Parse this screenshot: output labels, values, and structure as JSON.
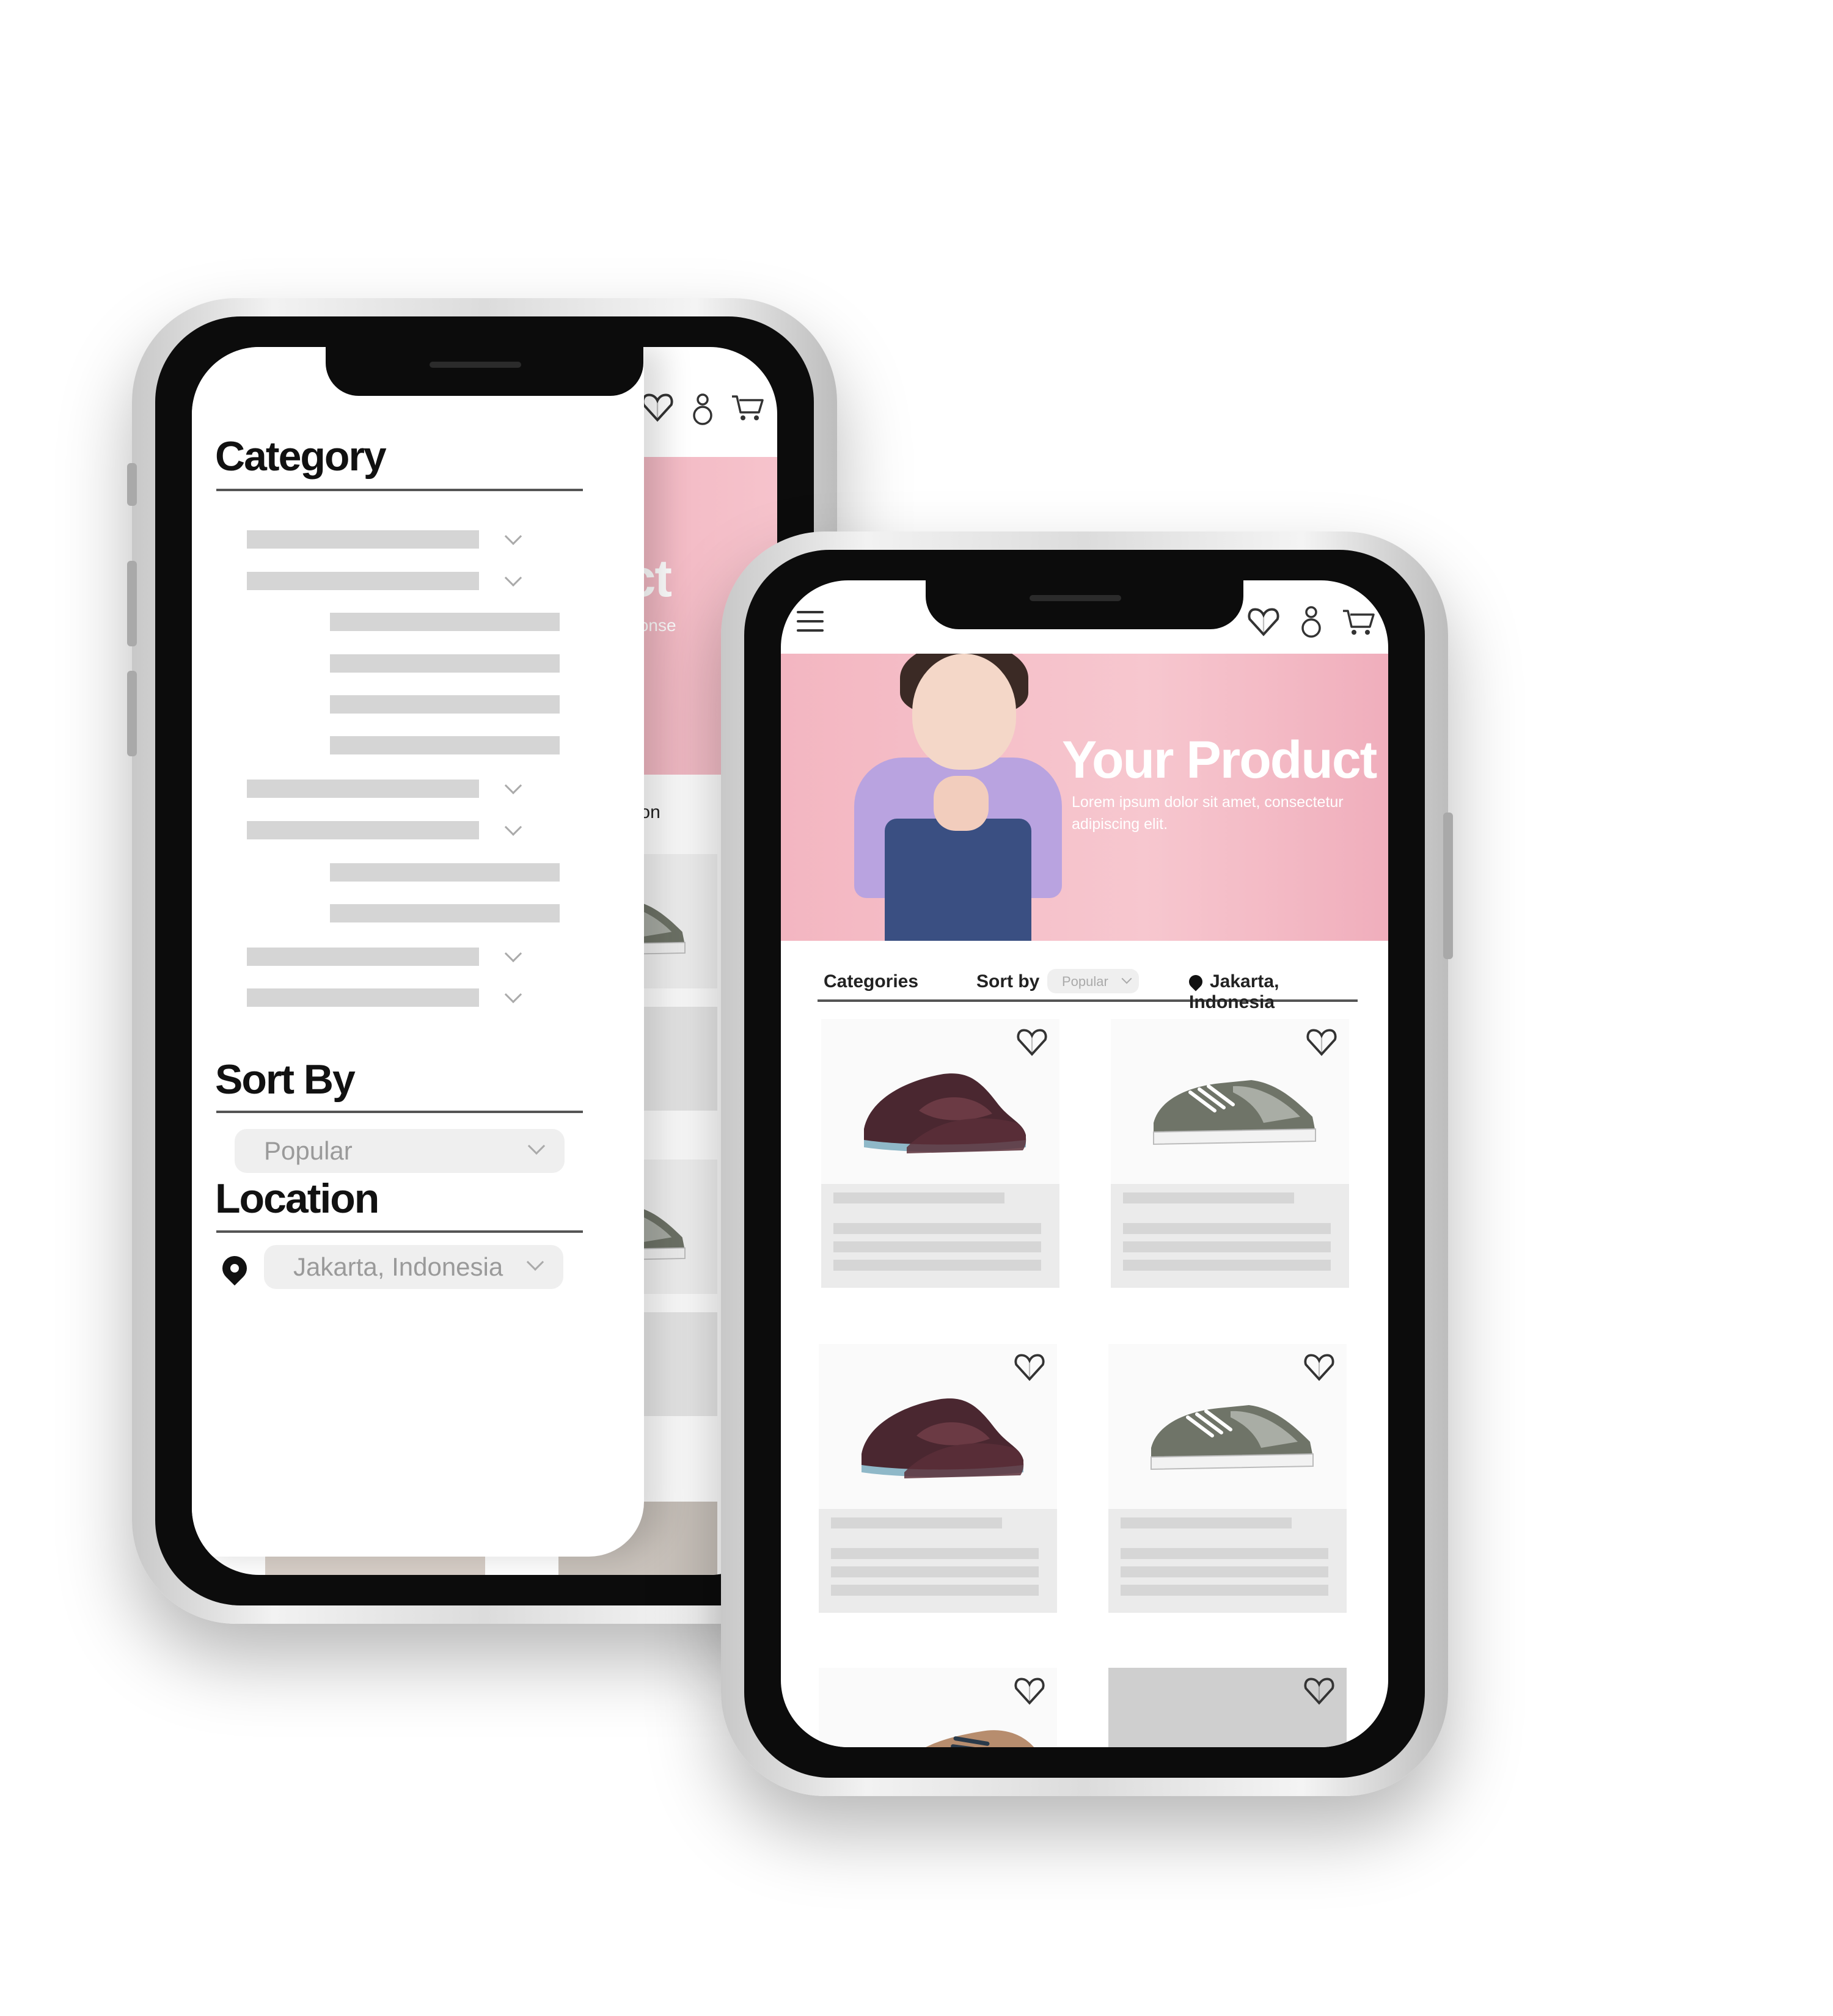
{
  "filter_drawer": {
    "category_heading": "Category",
    "sort_heading": "Sort By",
    "sort_value": "Popular",
    "location_heading": "Location",
    "location_value": "Jakarta, Indonesia"
  },
  "behind_drawer": {
    "hero_title_fragment": "oduct",
    "hero_sub_fragment": "amet, conse",
    "location_fragment": "rta, Indon"
  },
  "header": {
    "icons": [
      "menu-icon",
      "heart-icon",
      "user-icon",
      "cart-icon"
    ]
  },
  "hero": {
    "title": "Your Product",
    "subtitle": "Lorem ipsum dolor sit amet, consectetur adipiscing elit."
  },
  "filters": {
    "categories_label": "Categories",
    "sort_label": "Sort by",
    "sort_value": "Popular",
    "location": "Jakarta, Indonesia"
  },
  "products": [
    {
      "image": "slip-on-shoe"
    },
    {
      "image": "sneaker-shoe"
    },
    {
      "image": "slip-on-shoe"
    },
    {
      "image": "sneaker-shoe"
    },
    {
      "image": "derby-shoe"
    },
    {
      "image": "gray-placeholder"
    }
  ],
  "colors": {
    "hero_pink": "#f3b6c1",
    "skeleton": "#d5d5d5",
    "dropdown_bg": "#efefef"
  }
}
